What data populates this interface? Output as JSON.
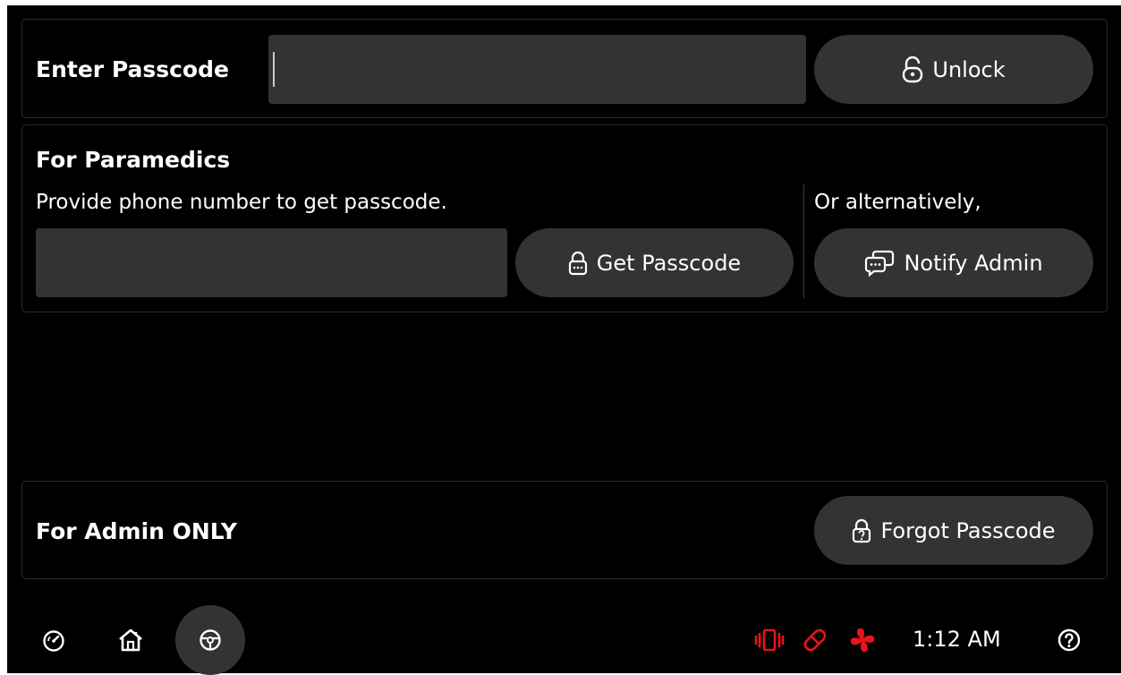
{
  "passcode": {
    "label": "Enter Passcode",
    "value": "",
    "unlock_label": "Unlock"
  },
  "paramedics": {
    "title": "For Paramedics",
    "instructions": "Provide phone number to get passcode.",
    "phone_value": "",
    "get_passcode_label": "Get Passcode",
    "alt_text": "Or alternatively,",
    "notify_admin_label": "Notify Admin"
  },
  "admin": {
    "title": "For Admin ONLY",
    "forgot_label": "Forgot Passcode"
  },
  "taskbar": {
    "left_icons": [
      "dashboard-icon",
      "home-icon",
      "steering-wheel-icon"
    ],
    "status_icons": [
      "vibration-icon",
      "pill-icon",
      "fan-icon"
    ],
    "time": "1:12 AM",
    "help_icon": "help-icon"
  },
  "colors": {
    "background": "#000000",
    "control": "#333333",
    "alert": "#e8131b",
    "text": "#ffffff"
  }
}
